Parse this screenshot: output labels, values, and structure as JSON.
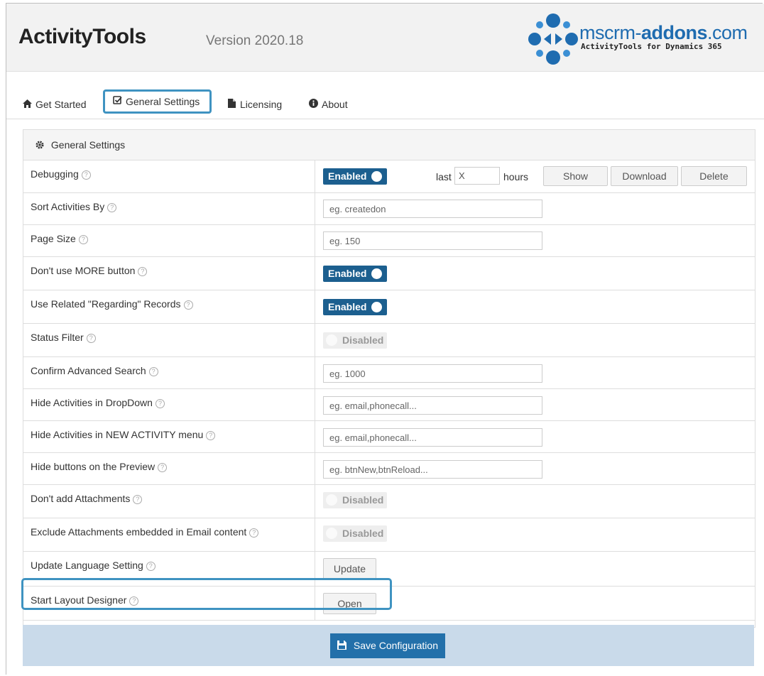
{
  "header": {
    "app_title": "ActivityTools",
    "version": "Version 2020.18",
    "logo_text_left": "mscrm-",
    "logo_text_bold": "addons",
    "logo_text_right": ".com",
    "logo_subtitle": "ActivityTools for Dynamics 365"
  },
  "tabs": [
    {
      "label": "Get Started",
      "icon": "home-icon",
      "glyph": "🏠"
    },
    {
      "label": "General Settings",
      "icon": "check-square-icon",
      "glyph": "☑"
    },
    {
      "label": "Licensing",
      "icon": "file-icon",
      "glyph": "📄"
    },
    {
      "label": "About",
      "icon": "info-icon",
      "glyph": "ℹ"
    }
  ],
  "panel": {
    "title": "General Settings",
    "icon": "gear-icon",
    "help_glyph": "?",
    "rows": {
      "debugging": {
        "label": "Debugging",
        "toggle": "Enabled",
        "last_label": "last",
        "last_value": "X",
        "hours_label": "hours",
        "show": "Show",
        "download": "Download",
        "delete": "Delete"
      },
      "sort_activities": {
        "label": "Sort Activities By",
        "placeholder": "eg. createdon"
      },
      "page_size": {
        "label": "Page Size",
        "placeholder": "eg. 150"
      },
      "more_button": {
        "label": "Don't use MORE button",
        "toggle": "Enabled"
      },
      "related_regarding": {
        "label": "Use Related \"Regarding\" Records",
        "toggle": "Enabled"
      },
      "status_filter": {
        "label": "Status Filter",
        "toggle": "Disabled"
      },
      "confirm_search": {
        "label": "Confirm Advanced Search",
        "placeholder": "eg. 1000"
      },
      "hide_dropdown": {
        "label": "Hide Activities in DropDown",
        "placeholder": "eg. email,phonecall..."
      },
      "hide_new_menu": {
        "label": "Hide Activities in NEW ACTIVITY menu",
        "placeholder": "eg. email,phonecall..."
      },
      "hide_preview_buttons": {
        "label": "Hide buttons on the Preview",
        "placeholder": "eg. btnNew,btnReload..."
      },
      "no_attachments": {
        "label": "Don't add Attachments",
        "toggle": "Disabled"
      },
      "exclude_embedded": {
        "label": "Exclude Attachments embedded in Email content",
        "toggle": "Disabled"
      },
      "update_language": {
        "label": "Update Language Setting",
        "button": "Update"
      },
      "layout_designer": {
        "label": "Start Layout Designer",
        "button": "Open"
      }
    }
  },
  "footer": {
    "save_label": "Save Configuration",
    "save_icon": "floppy-disk-icon",
    "save_glyph": "💾"
  },
  "colors": {
    "accent": "#1c5f8f",
    "highlight_border": "#3f93c1",
    "footer_bar": "#c9daea",
    "save_button": "#2370aa"
  }
}
